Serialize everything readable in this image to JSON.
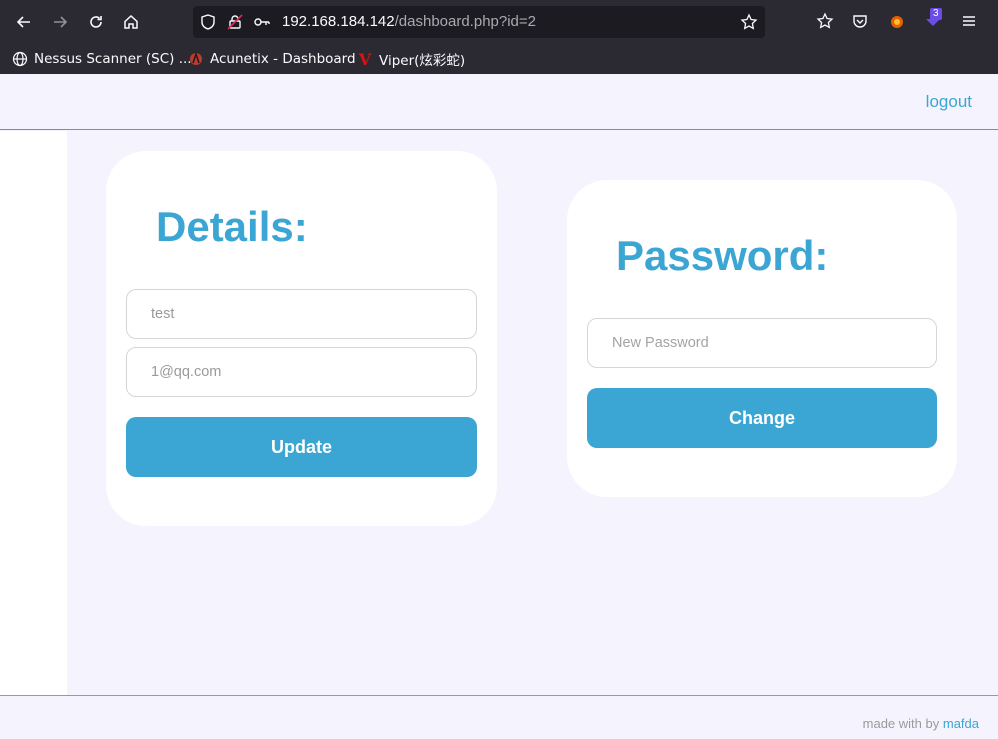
{
  "browser": {
    "url_host": "192.168.184.142",
    "url_path": "/dashboard.php?id=2",
    "extension_badge": "3",
    "bookmarks": [
      {
        "label": "Nessus Scanner (SC) ...",
        "icon": "globe-icon"
      },
      {
        "label": "Acunetix - Dashboard",
        "icon": "acunetix-logo-icon"
      },
      {
        "label": "Viper(炫彩蛇)",
        "icon": "viper-logo-icon"
      }
    ]
  },
  "header": {
    "logout_label": "logout"
  },
  "details": {
    "title": "Details:",
    "username_value": "test",
    "email_value": "1@qq.com",
    "update_label": "Update"
  },
  "password": {
    "title": "Password:",
    "new_password_placeholder": "New Password",
    "change_label": "Change"
  },
  "footer": {
    "made_with": "made with by",
    "author": "mafda"
  },
  "colors": {
    "accent": "#3ba6d3",
    "page_bg": "#f5f3fe",
    "chrome_bg": "#2b2a33",
    "urlbar_bg": "#1c1b22"
  }
}
